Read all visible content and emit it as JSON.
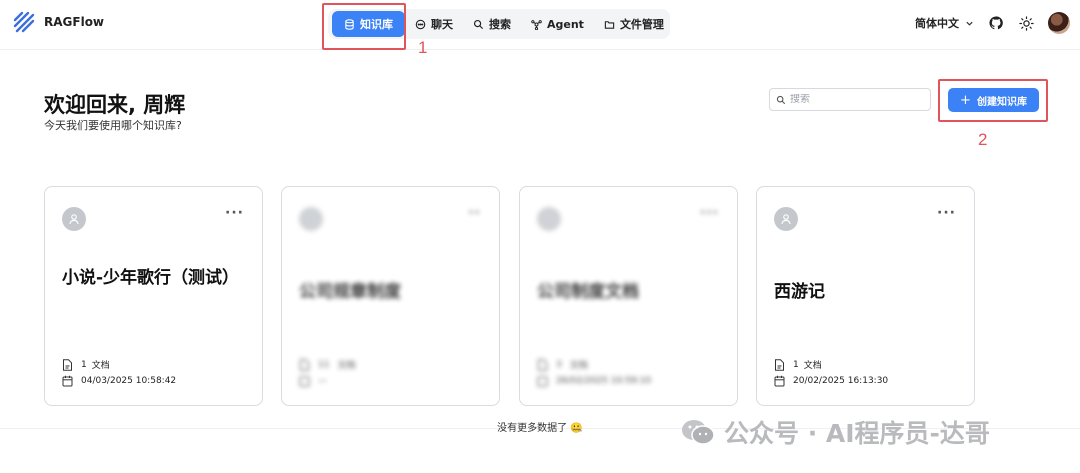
{
  "app": {
    "name": "RAGFlow"
  },
  "nav": {
    "items": [
      {
        "label": "知识库",
        "icon": "database-icon",
        "active": true
      },
      {
        "label": "聊天",
        "icon": "chat-icon",
        "active": false
      },
      {
        "label": "搜索",
        "icon": "search-icon",
        "active": false
      },
      {
        "label": "Agent",
        "icon": "agent-icon",
        "active": false
      },
      {
        "label": "文件管理",
        "icon": "folder-icon",
        "active": false
      }
    ]
  },
  "header": {
    "language": "简体中文"
  },
  "welcome": {
    "title": "欢迎回来, 周辉",
    "subtitle": "今天我们要使用哪个知识库?"
  },
  "search": {
    "placeholder": "搜索"
  },
  "create_button": {
    "label": "创建知识库"
  },
  "annotations": {
    "marker_1": "1",
    "marker_2": "2"
  },
  "cards": [
    {
      "title": "小说-少年歌行（测试）",
      "doc_count": "1",
      "doc_label": "文档",
      "date": "04/03/2025 10:58:42",
      "blurred": false
    },
    {
      "title": "公司规章制度",
      "doc_count": "11",
      "doc_label": "文档",
      "date": "—",
      "blurred": true
    },
    {
      "title": "公司制度文档",
      "doc_count": "3",
      "doc_label": "文档",
      "date": "26/02/2025 10:59:10",
      "blurred": true
    },
    {
      "title": "西游记",
      "doc_count": "1",
      "doc_label": "文档",
      "date": "20/02/2025 16:13:30",
      "blurred": false
    }
  ],
  "footer": {
    "note": "没有更多数据了 🤐"
  },
  "watermark": {
    "text": "公众号 · AI程序员-达哥"
  },
  "colors": {
    "accent": "#3b82f6",
    "annotation": "#e0555b"
  }
}
